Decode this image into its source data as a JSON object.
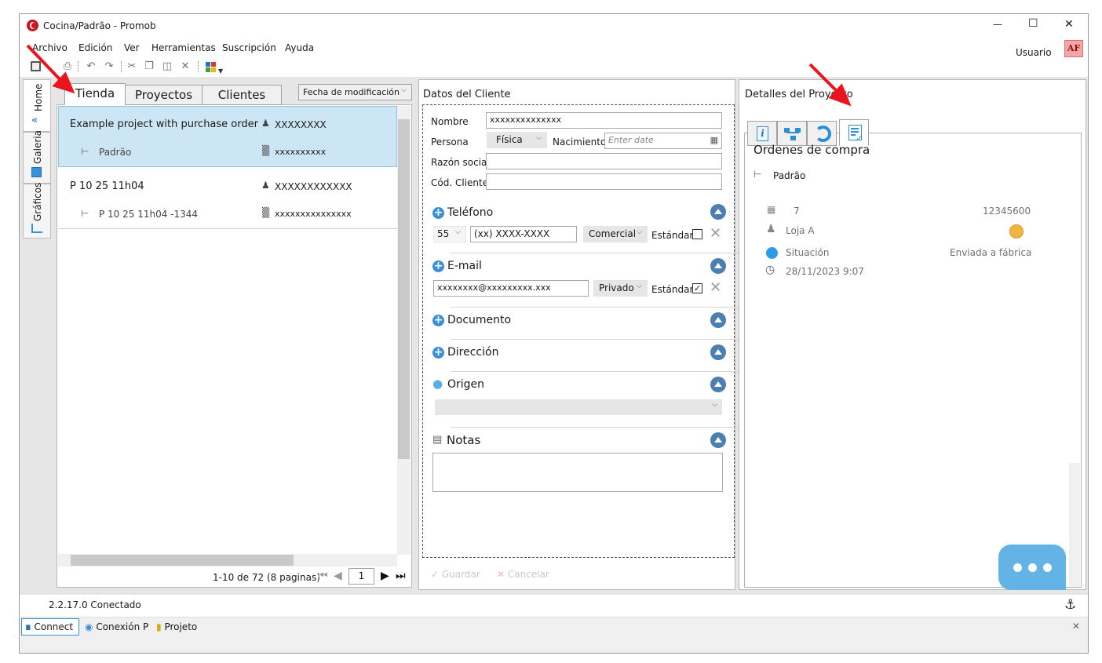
{
  "window": {
    "title": "Cocina/Padrão - Promob",
    "min_glyph": "—",
    "max_glyph": "☐",
    "close_glyph": "✕"
  },
  "menu": [
    "Archivo",
    "Edición",
    "Ver",
    "Herramientas",
    "Suscripción",
    "Ayuda"
  ],
  "user": {
    "label": "Usuario",
    "initials": "AF"
  },
  "side_tabs": [
    "Home",
    "Galeria",
    "Gráficos"
  ],
  "left": {
    "tabs": [
      "Tienda",
      "Proyectos",
      "Clientes"
    ],
    "sort": "Fecha de modificación",
    "projects": [
      {
        "name": "Example project with purchase order",
        "client": "XXXXXXXX",
        "environment": "Padrão",
        "store": "xxxxxxxxxx"
      },
      {
        "name": "P 10 25 11h04",
        "client": "XXXXXXXXXXXX",
        "environment": "P 10 25 11h04 -1344",
        "store": "xxxxxxxxxxxxxxx"
      }
    ],
    "pagination": {
      "summary": "1-10 de 72 (8 paginas)",
      "page": "1"
    }
  },
  "client": {
    "header": "Datos del Cliente",
    "nombre_label": "Nombre",
    "nombre_value": "xxxxxxxxxxxxxx",
    "persona_label": "Persona",
    "persona_value": "Física",
    "nacimiento_label": "Nacimiento",
    "nacimiento_placeholder": "Enter date",
    "razon_label": "Razón social",
    "cod_label": "Cód. Cliente",
    "telefono": {
      "title": "Teléfono",
      "code": "55",
      "number": "(xx) XXXX-XXXX",
      "type": "Comercial",
      "standard_label": "Estándar"
    },
    "email": {
      "title": "E-mail",
      "address": "xxxxxxxx@xxxxxxxxx.xxx",
      "type": "Privado",
      "standard_label": "Estándar"
    },
    "documento": "Documento",
    "direccion": "Dirección",
    "origen": "Origen",
    "notas": "Notas",
    "save": "Guardar",
    "cancel": "Cancelar"
  },
  "details": {
    "header": "Detalles del Proyecto",
    "section_title": "Ordenes de compra",
    "environment": "Padrão",
    "order_number": "7",
    "order_code": "12345600",
    "store": "Loja A",
    "situation_label": "Situación",
    "situation_value": "Enviada a fábrica",
    "date": "28/11/2023 9:07"
  },
  "status": {
    "version": "2.2.17.0 Conectado",
    "connect": "Connect",
    "conexion": "Conexión P",
    "projeto": "Projeto"
  },
  "colors": {
    "selected_row": "#cde6f5",
    "accent_blue": "#3a8fdb",
    "collapse_blue": "#4c7fb0",
    "chat_bubble": "#63b3e6",
    "arrow_red": "#e8141e"
  }
}
